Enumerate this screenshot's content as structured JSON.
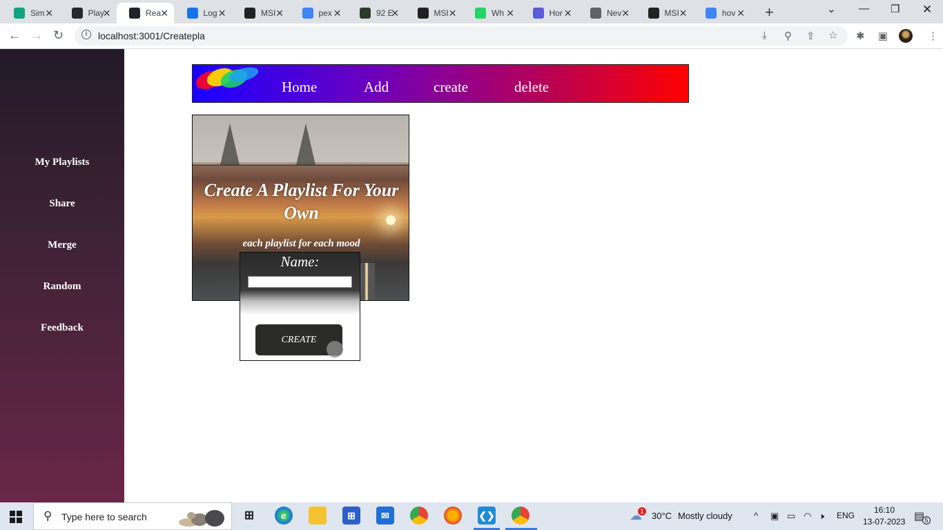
{
  "browser": {
    "tabs": [
      {
        "label": "Sim",
        "favicon": "chatgpt-icon",
        "color": "#10a37f"
      },
      {
        "label": "Play",
        "favicon": "github-icon",
        "color": "#24292f"
      },
      {
        "label": "Rea",
        "favicon": "react-icon",
        "color": "#20232a",
        "active": true
      },
      {
        "label": "Log",
        "favicon": "app-icon",
        "color": "#1a73e8"
      },
      {
        "label": "MSI",
        "favicon": "msft-icon",
        "color": "#222"
      },
      {
        "label": "pex",
        "favicon": "google-icon",
        "color": "#4285f4"
      },
      {
        "label": "92 E",
        "favicon": "cursor-icon",
        "color": "#2d3b2d"
      },
      {
        "label": "MSI",
        "favicon": "msft-icon",
        "color": "#222"
      },
      {
        "label": "Wh",
        "favicon": "whatsapp-icon",
        "color": "#25d366"
      },
      {
        "label": "Hor",
        "favicon": "edge-icon",
        "color": "#5b5bd6"
      },
      {
        "label": "Nev",
        "favicon": "chrome-icon",
        "color": "#5f6368"
      },
      {
        "label": "MSI",
        "favicon": "msft-icon",
        "color": "#222"
      },
      {
        "label": "hov",
        "favicon": "google-icon",
        "color": "#4285f4"
      }
    ],
    "url": "localhost:3001/Createpla"
  },
  "sidebar": {
    "items": [
      "My Playlists",
      "Share",
      "Merge",
      "Random",
      "Feedback"
    ]
  },
  "nav": {
    "links": [
      "Home",
      "Add",
      "create",
      "delete"
    ],
    "gradient_start": "#1a00ff",
    "gradient_end": "#ff0000"
  },
  "hero": {
    "title": "Create A Playlist For Your Own",
    "subtitle": "each playlist for each mood"
  },
  "form": {
    "label": "Name:",
    "name_value": "",
    "button": "CREATE"
  },
  "taskbar": {
    "search_placeholder": "Type here to search",
    "weather_temp": "30°C",
    "weather_desc": "Mostly cloudy",
    "weather_badge": "1",
    "language": "ENG",
    "time": "16:10",
    "date": "13-07-2023",
    "notifications": "5"
  }
}
